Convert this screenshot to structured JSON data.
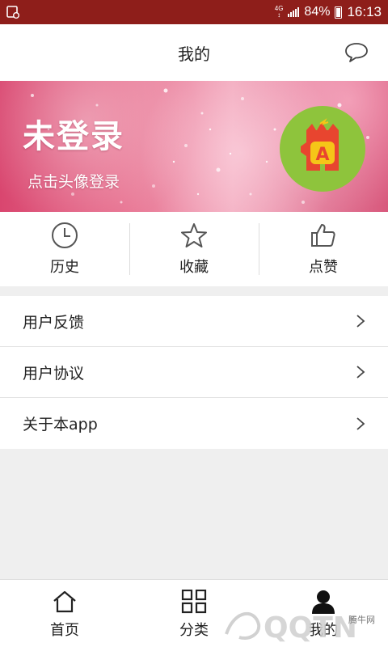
{
  "status_bar": {
    "network": "4G",
    "battery": "84%",
    "time": "16:13"
  },
  "header": {
    "title": "我的",
    "message_icon": "speech-bubble-icon"
  },
  "banner": {
    "title": "未登录",
    "subtitle": "点击头像登录",
    "avatar_letter": "A"
  },
  "shortcuts": [
    {
      "label": "历史",
      "icon": "clock-icon"
    },
    {
      "label": "收藏",
      "icon": "star-icon"
    },
    {
      "label": "点赞",
      "icon": "thumbs-up-icon"
    }
  ],
  "menu": [
    {
      "label": "用户反馈"
    },
    {
      "label": "用户协议"
    },
    {
      "label": "关于本app"
    }
  ],
  "tabbar": [
    {
      "label": "首页",
      "icon": "home-icon"
    },
    {
      "label": "分类",
      "icon": "grid-icon"
    },
    {
      "label": "我的",
      "icon": "user-icon",
      "active": true
    }
  ],
  "watermark": {
    "text": "QQTN",
    "site": "腾牛网"
  },
  "colors": {
    "status_bar": "#8e1e1a",
    "avatar_bg": "#8ec43c",
    "avatar_badge": "#e8452f",
    "badge_letter": "#f5c518"
  }
}
